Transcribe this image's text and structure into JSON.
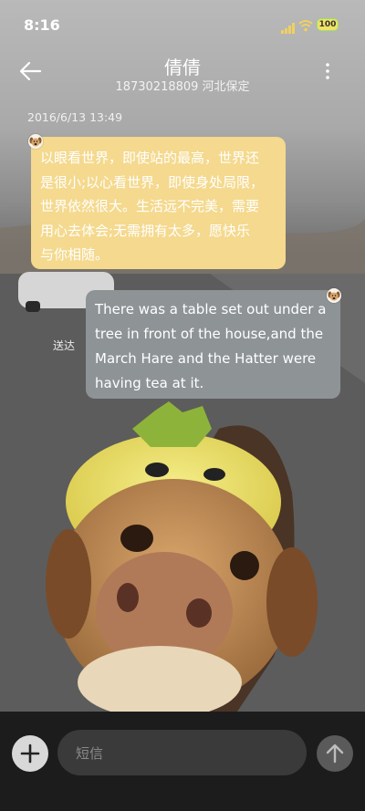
{
  "status_bar": {
    "time": "8:16",
    "battery": "100",
    "icons": [
      "signal-icon",
      "wifi-icon",
      "battery-icon"
    ]
  },
  "header": {
    "contact_name": "倩倩",
    "contact_detail": "18730218809 河北保定",
    "back_icon": "back-arrow-icon",
    "more_icon": "more-vertical-icon"
  },
  "conversation": {
    "date": "2016/6/13 13:49",
    "messages": [
      {
        "direction": "incoming",
        "avatar_icon": "dog-avatar-icon",
        "lines": [
          "以眼看世界，即使站的最高，世界还",
          "是很小;以心看世界，即使身处局限，",
          "世界依然很大。生活远不完美，需要",
          "用心去体会;无需拥有太多，愿快乐",
          "与你相随。"
        ],
        "bubble_color": "#f4d98e"
      },
      {
        "direction": "outgoing",
        "avatar_icon": "dog-avatar-icon",
        "lines": [
          "There was a table set out under a",
          "tree in front of the house,and the",
          "March Hare and the Hatter were",
          "having tea at it."
        ],
        "status": "送达",
        "bubble_color": "#8e9396"
      }
    ]
  },
  "composer": {
    "placeholder": "短信",
    "add_icon": "plus-icon",
    "send_icon": "send-arrow-icon"
  }
}
